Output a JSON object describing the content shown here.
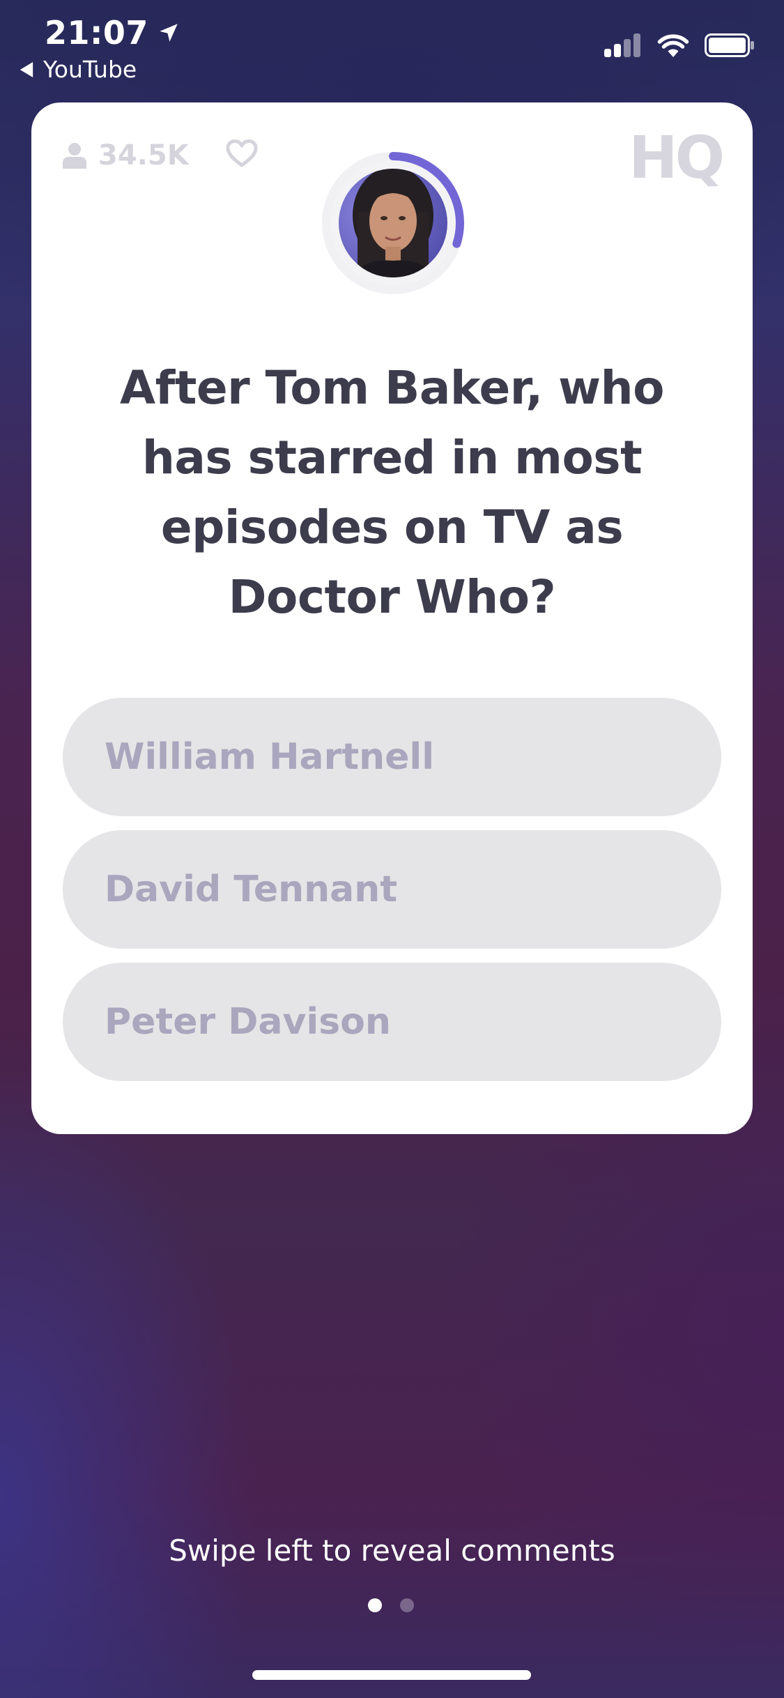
{
  "status_bar": {
    "time": "21:07",
    "back_label": "YouTube"
  },
  "game": {
    "viewer_count": "34.5K",
    "logo": "HQ",
    "timer_progress": 0.3,
    "question": "After Tom Baker, who has starred in most episodes on TV as Doctor Who?",
    "answers": [
      {
        "label": "William Hartnell"
      },
      {
        "label": "David Tennant"
      },
      {
        "label": "Peter Davison"
      }
    ]
  },
  "footer": {
    "swipe_hint": "Swipe left to reveal comments",
    "page_count": 2,
    "active_page": 1
  },
  "colors": {
    "accent": "#7266d6",
    "question_text": "#3d3c4d",
    "answer_bg": "#e5e5e7",
    "answer_text": "#a9a6bd"
  },
  "icons": [
    "location-arrow-icon",
    "back-triangle-icon",
    "signal-icon",
    "wifi-icon",
    "battery-icon",
    "user-icon",
    "heart-icon",
    "host-avatar",
    "timer-ring"
  ]
}
